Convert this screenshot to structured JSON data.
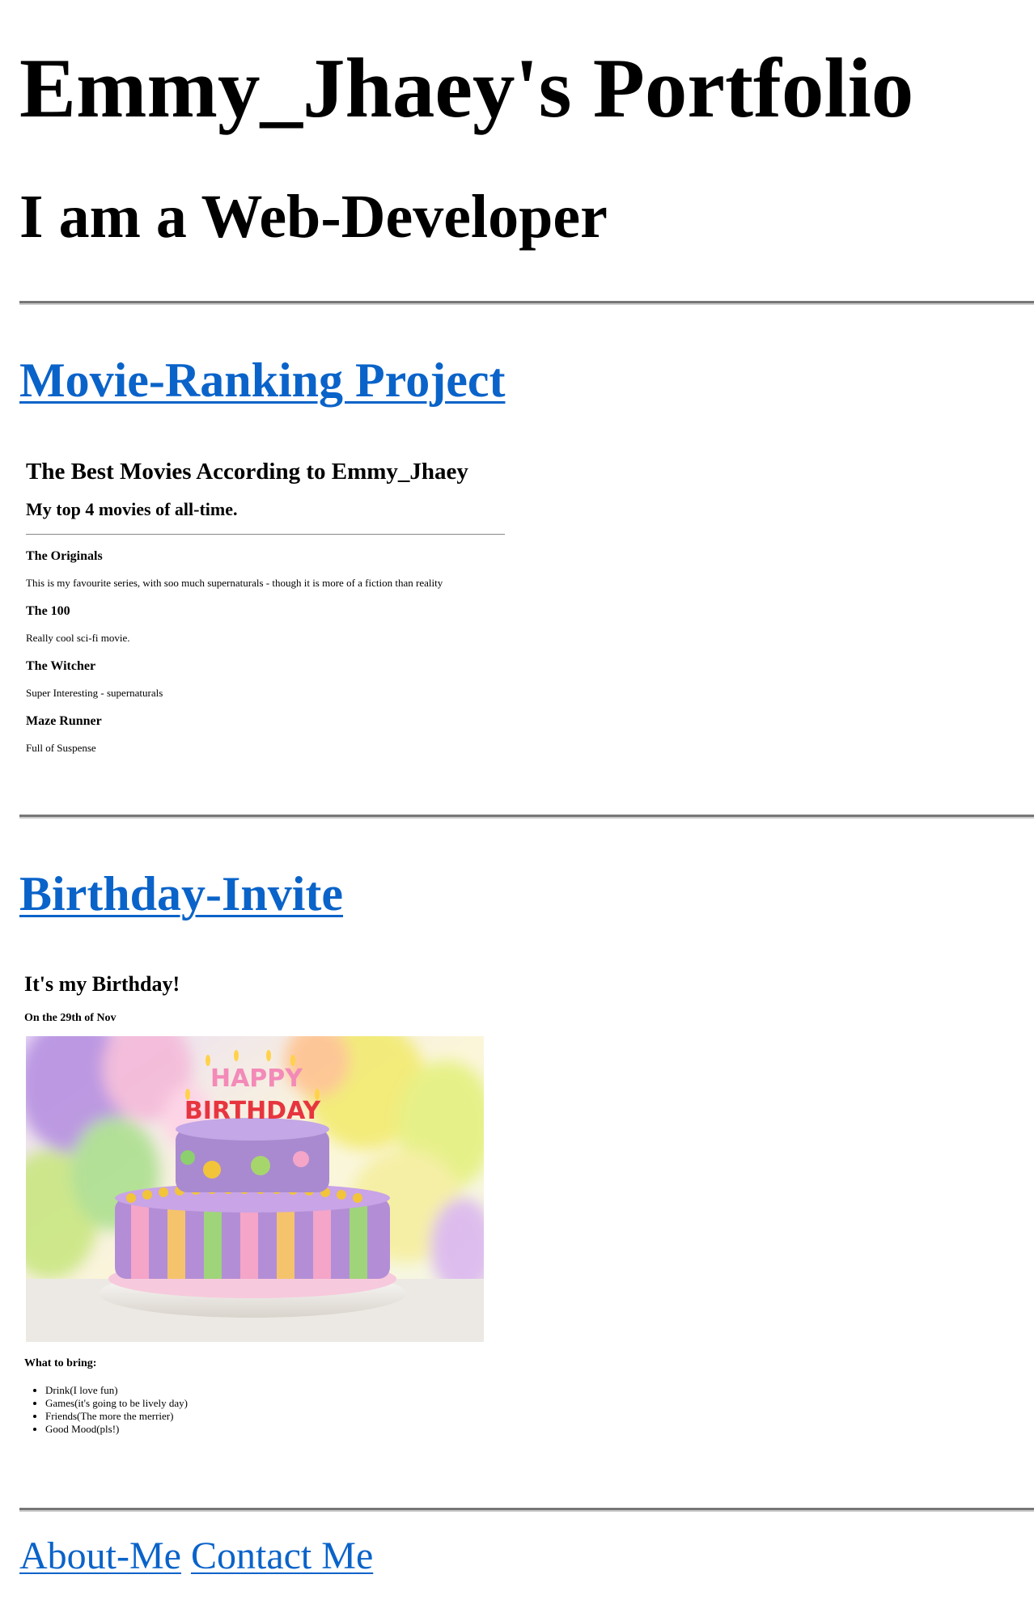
{
  "header": {
    "title": "Emmy_Jhaey's Portfolio",
    "subtitle": "I am a Web-Developer"
  },
  "projects": {
    "movie_link": "Movie-Ranking Project",
    "birthday_link": "Birthday-Invite"
  },
  "movie": {
    "heading": "The Best Movies According to Emmy_Jhaey",
    "subheading": "My top 4 movies of all-time.",
    "items": [
      {
        "title": "The Originals",
        "desc": "This is my favourite series, with soo much supernaturals - though it is more of a fiction than reality"
      },
      {
        "title": "The 100",
        "desc": "Really cool sci-fi movie."
      },
      {
        "title": "The Witcher",
        "desc": "Super Interesting - supernaturals"
      },
      {
        "title": "Maze Runner",
        "desc": "Full of Suspense"
      }
    ]
  },
  "birthday": {
    "heading": "It's my Birthday!",
    "date": "On the 29th of Nov",
    "cake_letters_top": "HAPPY",
    "cake_letters_bottom": "BIRTHDAY",
    "bring_heading": "What to bring:",
    "bring_items": [
      "Drink(I love fun)",
      "Games(it's going to be lively day)",
      "Friends(The more the merrier)",
      "Good Mood(pls!)"
    ]
  },
  "footer": {
    "about_link": "About-Me",
    "contact_link": "Contact Me"
  },
  "colors": {
    "link": "#0a63c9",
    "rule": "#777777"
  }
}
